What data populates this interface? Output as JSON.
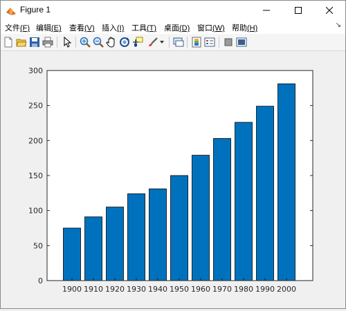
{
  "window": {
    "title": "Figure 1",
    "controls": [
      "minimize",
      "maximize",
      "close"
    ]
  },
  "menu": {
    "items": [
      {
        "label": "文件",
        "key": "(F)"
      },
      {
        "label": "编辑",
        "key": "(E)"
      },
      {
        "label": "查看",
        "key": "(V)"
      },
      {
        "label": "插入",
        "key": "(I)"
      },
      {
        "label": "工具",
        "key": "(T)"
      },
      {
        "label": "桌面",
        "key": "(D)"
      },
      {
        "label": "窗口",
        "key": "(W)"
      },
      {
        "label": "帮助",
        "key": "(H)"
      }
    ],
    "overflow": "↘"
  },
  "toolbar": {
    "icons": [
      "new-figure-icon",
      "open-file-icon",
      "save-icon",
      "print-icon",
      "pointer-icon",
      "zoom-in-icon",
      "zoom-out-icon",
      "pan-icon",
      "rotate-3d-icon",
      "data-cursor-icon",
      "brush-icon",
      "link-plot-icon",
      "colorbar-icon",
      "legend-icon",
      "hide-plot-tools-icon",
      "show-plot-tools-icon"
    ]
  },
  "chart_data": {
    "type": "bar",
    "categories": [
      "1900",
      "1910",
      "1920",
      "1930",
      "1940",
      "1950",
      "1960",
      "1970",
      "1980",
      "1990",
      "2000"
    ],
    "values": [
      75,
      91,
      105,
      124,
      131,
      150,
      179,
      203,
      226,
      249,
      281
    ],
    "title": "",
    "xlabel": "",
    "ylabel": "",
    "ylim": [
      0,
      300
    ],
    "yticks": [
      0,
      50,
      100,
      150,
      200,
      250,
      300
    ],
    "bar_color": "#0072bd",
    "edge_color": "#000000",
    "grid": false
  }
}
